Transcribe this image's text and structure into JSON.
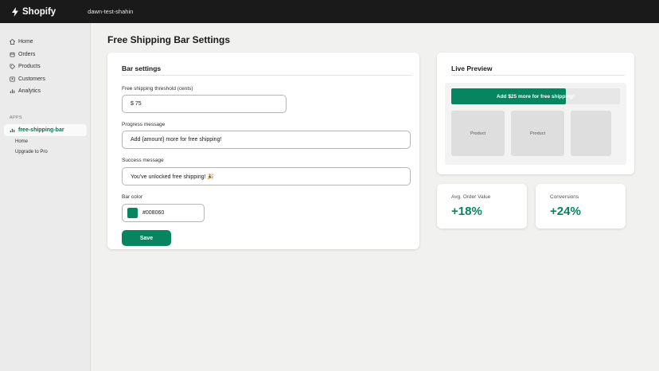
{
  "topbar": {
    "brand": "Shopify",
    "store": "dawn-test-shahin"
  },
  "sidebar": {
    "items": [
      {
        "label": "Home",
        "icon": "home-icon"
      },
      {
        "label": "Orders",
        "icon": "orders-icon"
      },
      {
        "label": "Products",
        "icon": "tag-icon"
      },
      {
        "label": "Customers",
        "icon": "customers-icon"
      },
      {
        "label": "Analytics",
        "icon": "analytics-icon"
      }
    ],
    "apps_label": "APPS",
    "app": {
      "label": "free-shipping-bar",
      "icon": "chart-icon"
    },
    "sub_items": [
      {
        "label": "Home"
      },
      {
        "label": "Upgrade to Pro"
      }
    ]
  },
  "page": {
    "title": "Free Shipping Bar Settings"
  },
  "settings": {
    "heading": "Bar settings",
    "threshold": {
      "label": "Free shipping threshold (cents)",
      "value": "$ 75"
    },
    "progress": {
      "label": "Progress message",
      "value": "Add {amount} more for free shipping!"
    },
    "success": {
      "label": "Success message",
      "value": "You've unlocked free shipping! 🎉"
    },
    "color": {
      "label": "Bar color",
      "value": "#008060"
    },
    "save_label": "Save"
  },
  "preview": {
    "heading": "Live Preview",
    "bar_text": "Add $25 more for free shipping!",
    "progress_fraction": 0.68,
    "products": [
      "Product",
      "Product",
      ""
    ]
  },
  "stats": [
    {
      "label": "Avg. Order Value",
      "value": "+18%"
    },
    {
      "label": "Conversions",
      "value": "+24%"
    }
  ],
  "colors": {
    "accent": "#078560",
    "topbar": "#1a1a1a",
    "sidebar": "#ebebeb",
    "background": "#f1f2f0",
    "app_label": "#0b6e4f"
  }
}
